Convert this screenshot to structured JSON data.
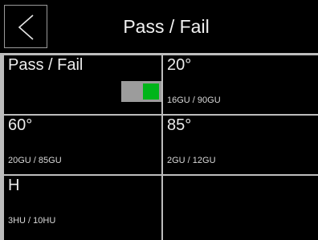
{
  "header": {
    "back_icon": "chevron-left-icon",
    "title": "Pass / Fail"
  },
  "cells": [
    {
      "title": "Pass / Fail",
      "toggle_on": true,
      "toggle_color": "#00b51a"
    },
    {
      "title": "20°",
      "sub": "16GU / 90GU"
    },
    {
      "title": "60°",
      "sub": "20GU / 85GU"
    },
    {
      "title": "85°",
      "sub": "2GU / 12GU"
    },
    {
      "title": "H",
      "sub": "3HU / 10HU"
    },
    {
      "title": ""
    }
  ]
}
